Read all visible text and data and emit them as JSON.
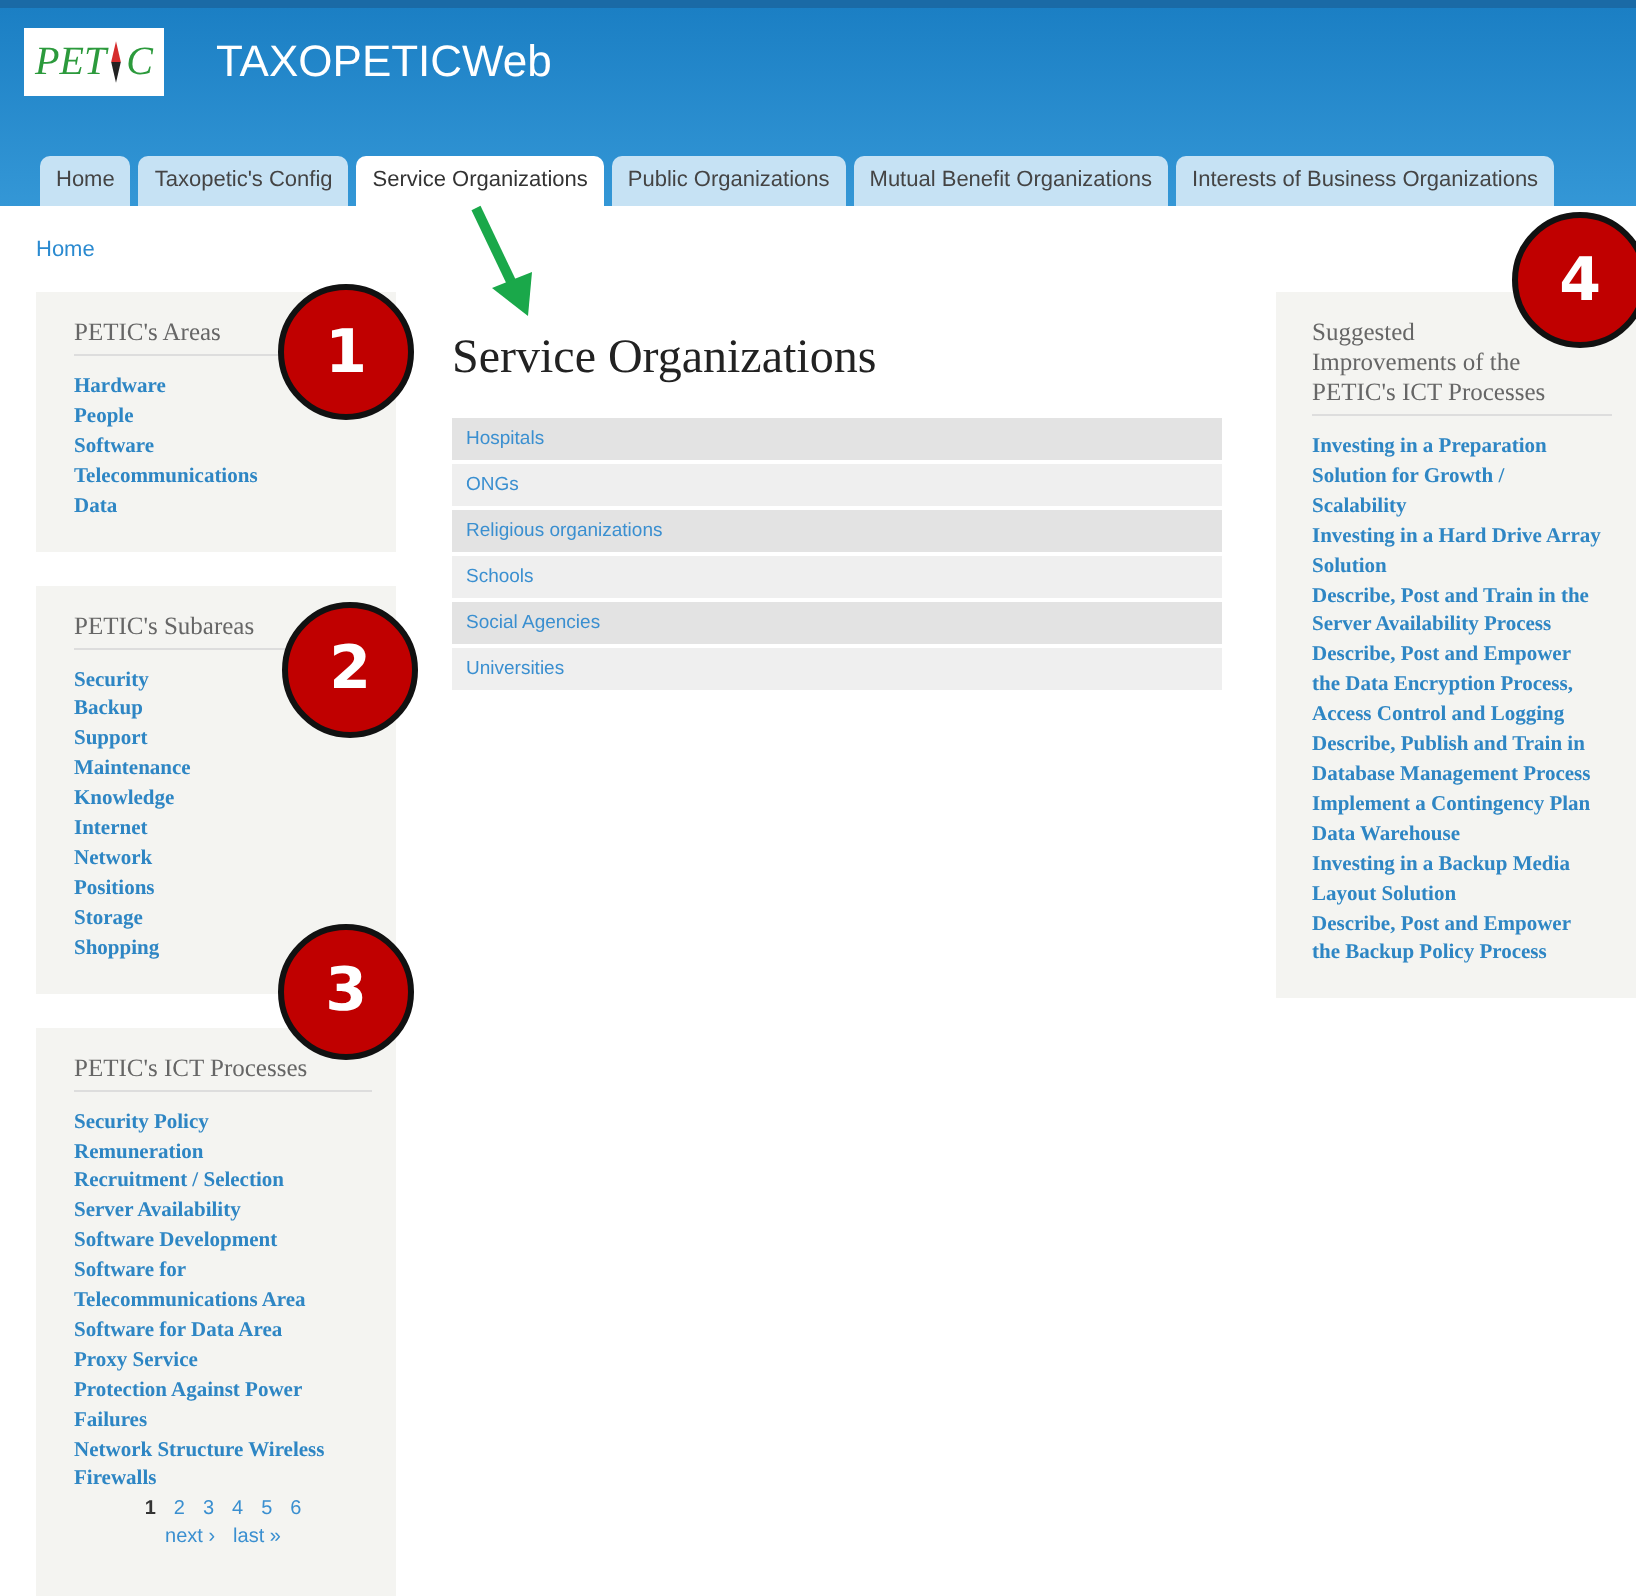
{
  "header": {
    "logo": {
      "text_left": "PET",
      "text_right": "C"
    },
    "title": "TAXOPETICWeb"
  },
  "tabs": [
    {
      "label": "Home",
      "selected": false
    },
    {
      "label": "Taxopetic's Config",
      "selected": false
    },
    {
      "label": "Service Organizations",
      "selected": true
    },
    {
      "label": "Public Organizations",
      "selected": false
    },
    {
      "label": "Mutual Benefit Organizations",
      "selected": false
    },
    {
      "label": "Interests of Business Organizations",
      "selected": false
    }
  ],
  "breadcrumb": "Home",
  "left_sidebar": [
    {
      "title": "PETIC's Areas",
      "callout": "1",
      "links": [
        "Hardware",
        "People",
        "Software",
        "Telecommunications",
        "Data"
      ]
    },
    {
      "title": "PETIC's Subareas",
      "callout": "2",
      "links": [
        "Security",
        "Backup",
        "Support",
        "Maintenance",
        "Knowledge",
        "Internet",
        "Network",
        "Positions",
        "Storage",
        "Shopping"
      ]
    },
    {
      "title": "PETIC's ICT Processes",
      "callout": "3",
      "links": [
        "Security Policy",
        "Remuneration",
        "Recruitment / Selection",
        "Server Availability",
        "Software Development",
        "Software for Telecommunications Area",
        "Software for Data Area",
        "Proxy Service",
        "Protection Against Power Failures",
        "Network Structure Wireless Firewalls"
      ],
      "pager": {
        "pages": [
          {
            "label": "1",
            "selected": true
          },
          {
            "label": "2",
            "selected": false
          },
          {
            "label": "3",
            "selected": false
          },
          {
            "label": "4",
            "selected": false
          },
          {
            "label": "5",
            "selected": false
          },
          {
            "label": "6",
            "selected": false
          }
        ],
        "next": "next ›",
        "last": "last »"
      }
    }
  ],
  "main": {
    "heading": "Service Organizations",
    "items": [
      "Hospitals",
      "ONGs",
      "Religious organizations",
      "Schools",
      "Social Agencies",
      "Universities"
    ]
  },
  "right_sidebar": {
    "title": "Suggested Improvements of the PETIC's ICT Processes",
    "callout": "4",
    "links": [
      "Investing in a Preparation Solution for Growth / Scalability",
      "Investing in a Hard Drive Array Solution",
      "Describe, Post and Train in the Server Availability Process",
      "Describe, Post and Empower the Data Encryption Process, Access Control and Logging",
      "Describe, Publish and Train in Database Management Process",
      "Implement a Contingency Plan Data Warehouse",
      "Investing in a Backup Media Layout Solution",
      "Describe, Post and Empower the Backup Policy Process"
    ]
  }
}
